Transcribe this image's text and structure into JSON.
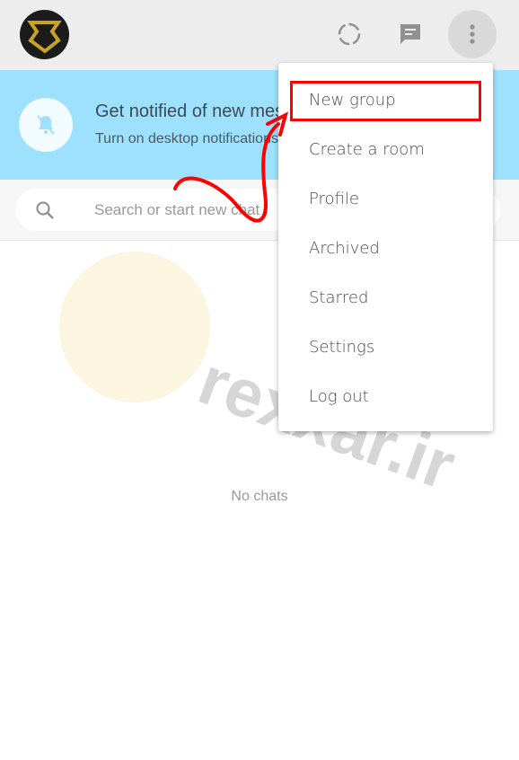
{
  "header": {
    "avatar": "user-avatar",
    "icons": [
      "status-icon",
      "new-chat-icon",
      "menu-icon"
    ]
  },
  "banner": {
    "title": "Get notified of new messages",
    "subtitle": "Turn on desktop notifications",
    "icon": "bell-off-icon"
  },
  "search": {
    "placeholder": "Search or start new chat",
    "icon": "search-icon"
  },
  "chat_list": {
    "empty_text": "No chats"
  },
  "menu": {
    "items": [
      "New group",
      "Create a room",
      "Profile",
      "Archived",
      "Starred",
      "Settings",
      "Log out"
    ],
    "highlighted": "New group"
  },
  "annotation": {
    "color": "#ff0000"
  },
  "watermark": {
    "text": "rexxar.ir"
  }
}
